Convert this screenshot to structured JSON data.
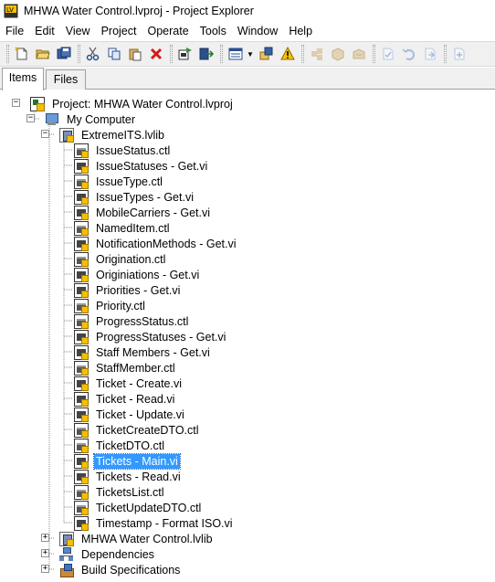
{
  "window": {
    "title": "MHWA Water Control.lvproj - Project Explorer"
  },
  "menu": [
    "File",
    "Edit",
    "View",
    "Project",
    "Operate",
    "Tools",
    "Window",
    "Help"
  ],
  "toolbar": {
    "buttons": [
      {
        "name": "new-icon",
        "enabled": true
      },
      {
        "name": "open-icon",
        "enabled": true
      },
      {
        "name": "save-all-icon",
        "enabled": true
      },
      {
        "name": "cut-icon",
        "enabled": true
      },
      {
        "name": "copy-icon",
        "enabled": true
      },
      {
        "name": "paste-icon",
        "enabled": true
      },
      {
        "name": "delete-icon",
        "enabled": true
      },
      {
        "name": "build-icon",
        "enabled": true
      },
      {
        "name": "deploy-icon",
        "enabled": true
      },
      {
        "name": "view-icon",
        "enabled": true
      },
      {
        "name": "add-icon",
        "enabled": true
      },
      {
        "name": "warning-icon",
        "enabled": true
      },
      {
        "name": "source-control-1-icon",
        "enabled": false
      },
      {
        "name": "source-control-2-icon",
        "enabled": false
      },
      {
        "name": "source-control-3-icon",
        "enabled": false
      },
      {
        "name": "checkout-icon",
        "enabled": false
      },
      {
        "name": "undo-checkout-icon",
        "enabled": false
      },
      {
        "name": "checkin-icon",
        "enabled": false
      },
      {
        "name": "add-to-sc-icon",
        "enabled": false
      }
    ]
  },
  "tabs": {
    "items": "Items",
    "files": "Files"
  },
  "tree": {
    "project": "Project: MHWA Water Control.lvproj",
    "my_computer": "My Computer",
    "library": "ExtremeITS.lvlib",
    "library_items": [
      {
        "label": "IssueStatus.ctl",
        "type": "ctl"
      },
      {
        "label": "IssueStatuses - Get.vi",
        "type": "vi"
      },
      {
        "label": "IssueType.ctl",
        "type": "ctl"
      },
      {
        "label": "IssueTypes - Get.vi",
        "type": "vi"
      },
      {
        "label": "MobileCarriers - Get.vi",
        "type": "vi"
      },
      {
        "label": "NamedItem.ctl",
        "type": "ctl"
      },
      {
        "label": "NotificationMethods - Get.vi",
        "type": "vi"
      },
      {
        "label": "Origination.ctl",
        "type": "ctl"
      },
      {
        "label": "Originiations - Get.vi",
        "type": "vi"
      },
      {
        "label": "Priorities - Get.vi",
        "type": "vi"
      },
      {
        "label": "Priority.ctl",
        "type": "ctl"
      },
      {
        "label": "ProgressStatus.ctl",
        "type": "ctl"
      },
      {
        "label": "ProgressStatuses - Get.vi",
        "type": "vi"
      },
      {
        "label": "Staff Members - Get.vi",
        "type": "vi"
      },
      {
        "label": "StaffMember.ctl",
        "type": "ctl"
      },
      {
        "label": "Ticket - Create.vi",
        "type": "vi"
      },
      {
        "label": "Ticket - Read.vi",
        "type": "vi"
      },
      {
        "label": "Ticket - Update.vi",
        "type": "vi"
      },
      {
        "label": "TicketCreateDTO.ctl",
        "type": "ctl"
      },
      {
        "label": "TicketDTO.ctl",
        "type": "ctl"
      },
      {
        "label": "Tickets - Main.vi",
        "type": "vi",
        "selected": true
      },
      {
        "label": "Tickets - Read.vi",
        "type": "vi"
      },
      {
        "label": "TicketsList.ctl",
        "type": "ctl"
      },
      {
        "label": "TicketUpdateDTO.ctl",
        "type": "ctl"
      },
      {
        "label": "Timestamp - Format ISO.vi",
        "type": "vi"
      }
    ],
    "collapsed": [
      {
        "label": "MHWA Water Control.lvlib",
        "type": "lib"
      },
      {
        "label": "Dependencies",
        "type": "deps"
      },
      {
        "label": "Build Specifications",
        "type": "build"
      }
    ]
  },
  "colors": {
    "selection": "#3399ff",
    "toolbar_bg": "#f0f0f0"
  }
}
